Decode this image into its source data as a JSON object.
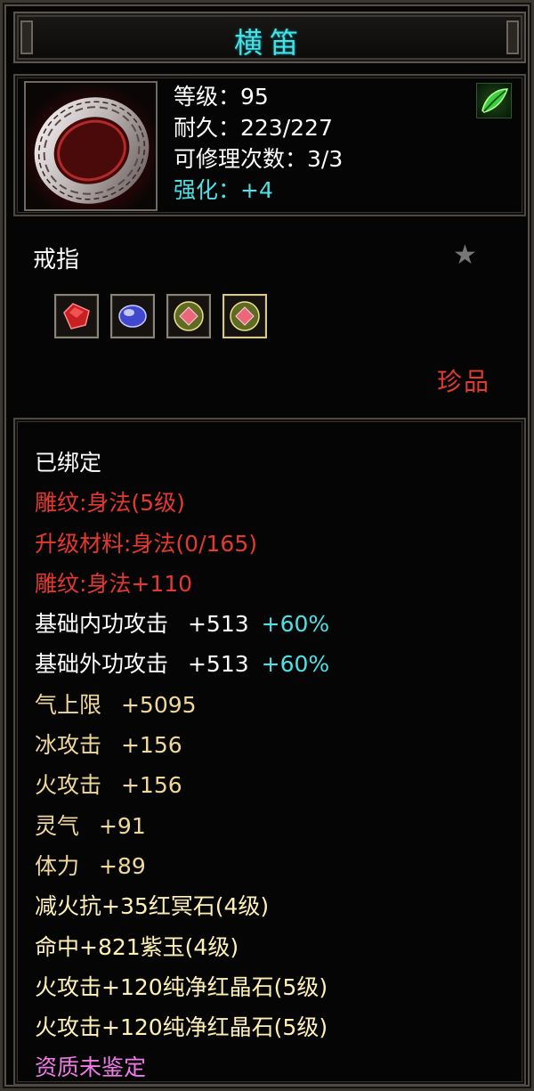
{
  "title": "横笛",
  "header": {
    "stats": [
      "等级：95",
      "耐久：223/227",
      "可修理次数：3/3"
    ],
    "enhance": "强化：+4",
    "item_icon": "silver-ring-icon",
    "badge_icon": "green-leaf-icon"
  },
  "type": {
    "label": "戒指",
    "favorite_icon": "star-icon",
    "gems": [
      {
        "name": "red-gem-icon",
        "color": "#d22a2a"
      },
      {
        "name": "purple-gem-icon",
        "color": "#4a52d8"
      },
      {
        "name": "red-crystal-icon",
        "color": "#e8677a"
      },
      {
        "name": "red-crystal-icon",
        "color": "#e8677a"
      }
    ],
    "rarity": "珍品"
  },
  "attributes": {
    "bound": "已绑定",
    "engrave": "雕纹:身法(5级)",
    "upgrade_material": "升级材料:身法(0/165)",
    "engrave_bonus": "雕纹:身法+110",
    "inner_attack": {
      "label": "基础内功攻击",
      "value": "+513",
      "bonus": "+60%"
    },
    "outer_attack": {
      "label": "基础外功攻击",
      "value": "+513",
      "bonus": "+60%"
    },
    "qi_limit": {
      "label": "气上限",
      "value": "+5095"
    },
    "ice_attack": {
      "label": "冰攻击",
      "value": "+156"
    },
    "fire_attack": {
      "label": "火攻击",
      "value": "+156"
    },
    "spirit": {
      "label": "灵气",
      "value": "+91"
    },
    "stamina": {
      "label": "体力",
      "value": "+89"
    },
    "gem_lines": [
      "减火抗+35红冥石(4级)",
      "命中+821紫玉(4级)",
      "火攻击+120纯净红晶石(5级)",
      "火攻击+120纯净红晶石(5级)"
    ],
    "quality": "资质未鉴定"
  },
  "colors": {
    "title": "#46e0e6",
    "enhance": "#4ee0e4",
    "red_text": "#e4392f",
    "gold_text": "#f0d89a",
    "pink_text": "#f07ae8"
  }
}
